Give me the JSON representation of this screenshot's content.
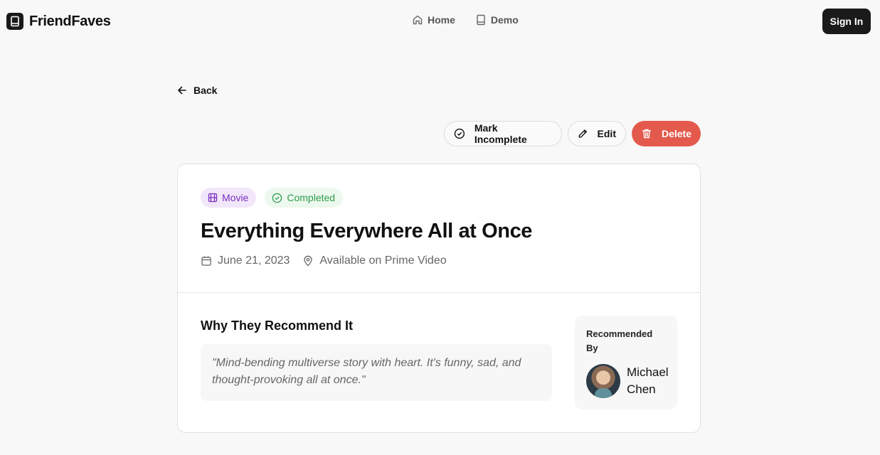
{
  "app": {
    "name": "FriendFaves"
  },
  "nav": {
    "items": [
      {
        "label": "Home",
        "icon": "home-icon"
      },
      {
        "label": "Demo",
        "icon": "book-icon"
      }
    ]
  },
  "header": {
    "signin_label": "Sign In"
  },
  "back": {
    "label": "Back"
  },
  "actions": {
    "mark_incomplete": "Mark Incomplete",
    "edit": "Edit",
    "delete": "Delete"
  },
  "item": {
    "type_badge": "Movie",
    "status_badge": "Completed",
    "title": "Everything Everywhere All at Once",
    "date": "June 21, 2023",
    "availability": "Available on Prime Video"
  },
  "recommendation": {
    "heading": "Why They Recommend It",
    "quote": "\"Mind-bending multiverse story with heart. It's funny, sad, and thought-provoking all at once.\"",
    "recommended_by_label": "Recommended By",
    "recommender_name": "Michael Chen"
  },
  "colors": {
    "delete": "#e35a4c",
    "movie_badge": "#7b2fbe",
    "completed_badge": "#2e9d4a",
    "primary_dark": "#1a1a1a"
  }
}
